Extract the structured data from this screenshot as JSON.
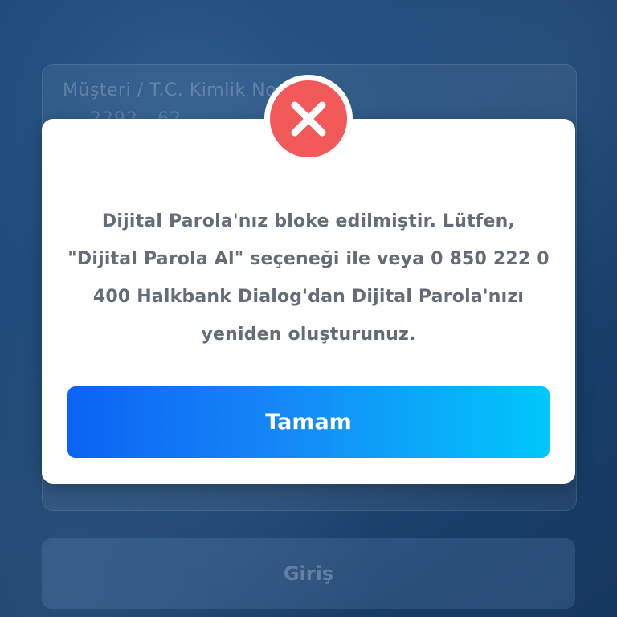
{
  "background": {
    "customer_label": "Müşteri / T.C. Kimlik No",
    "customer_value": "2292...62",
    "login_button_label": "Giriş"
  },
  "dialog": {
    "icon": "close-x-icon",
    "icon_color": "#f25a5a",
    "message_lines": [
      "Dijital Parola'nız bloke edilmiştir. Lütfen,",
      "\"Dijital Parola Al\" seçeneği ile veya 0 850 222 0",
      "400 Halkbank Dialog'dan Dijital Parola'nızı",
      "yeniden oluşturunuz."
    ],
    "ok_label": "Tamam",
    "button_gradient": [
      "#0b63f3",
      "#00c7fb"
    ]
  }
}
